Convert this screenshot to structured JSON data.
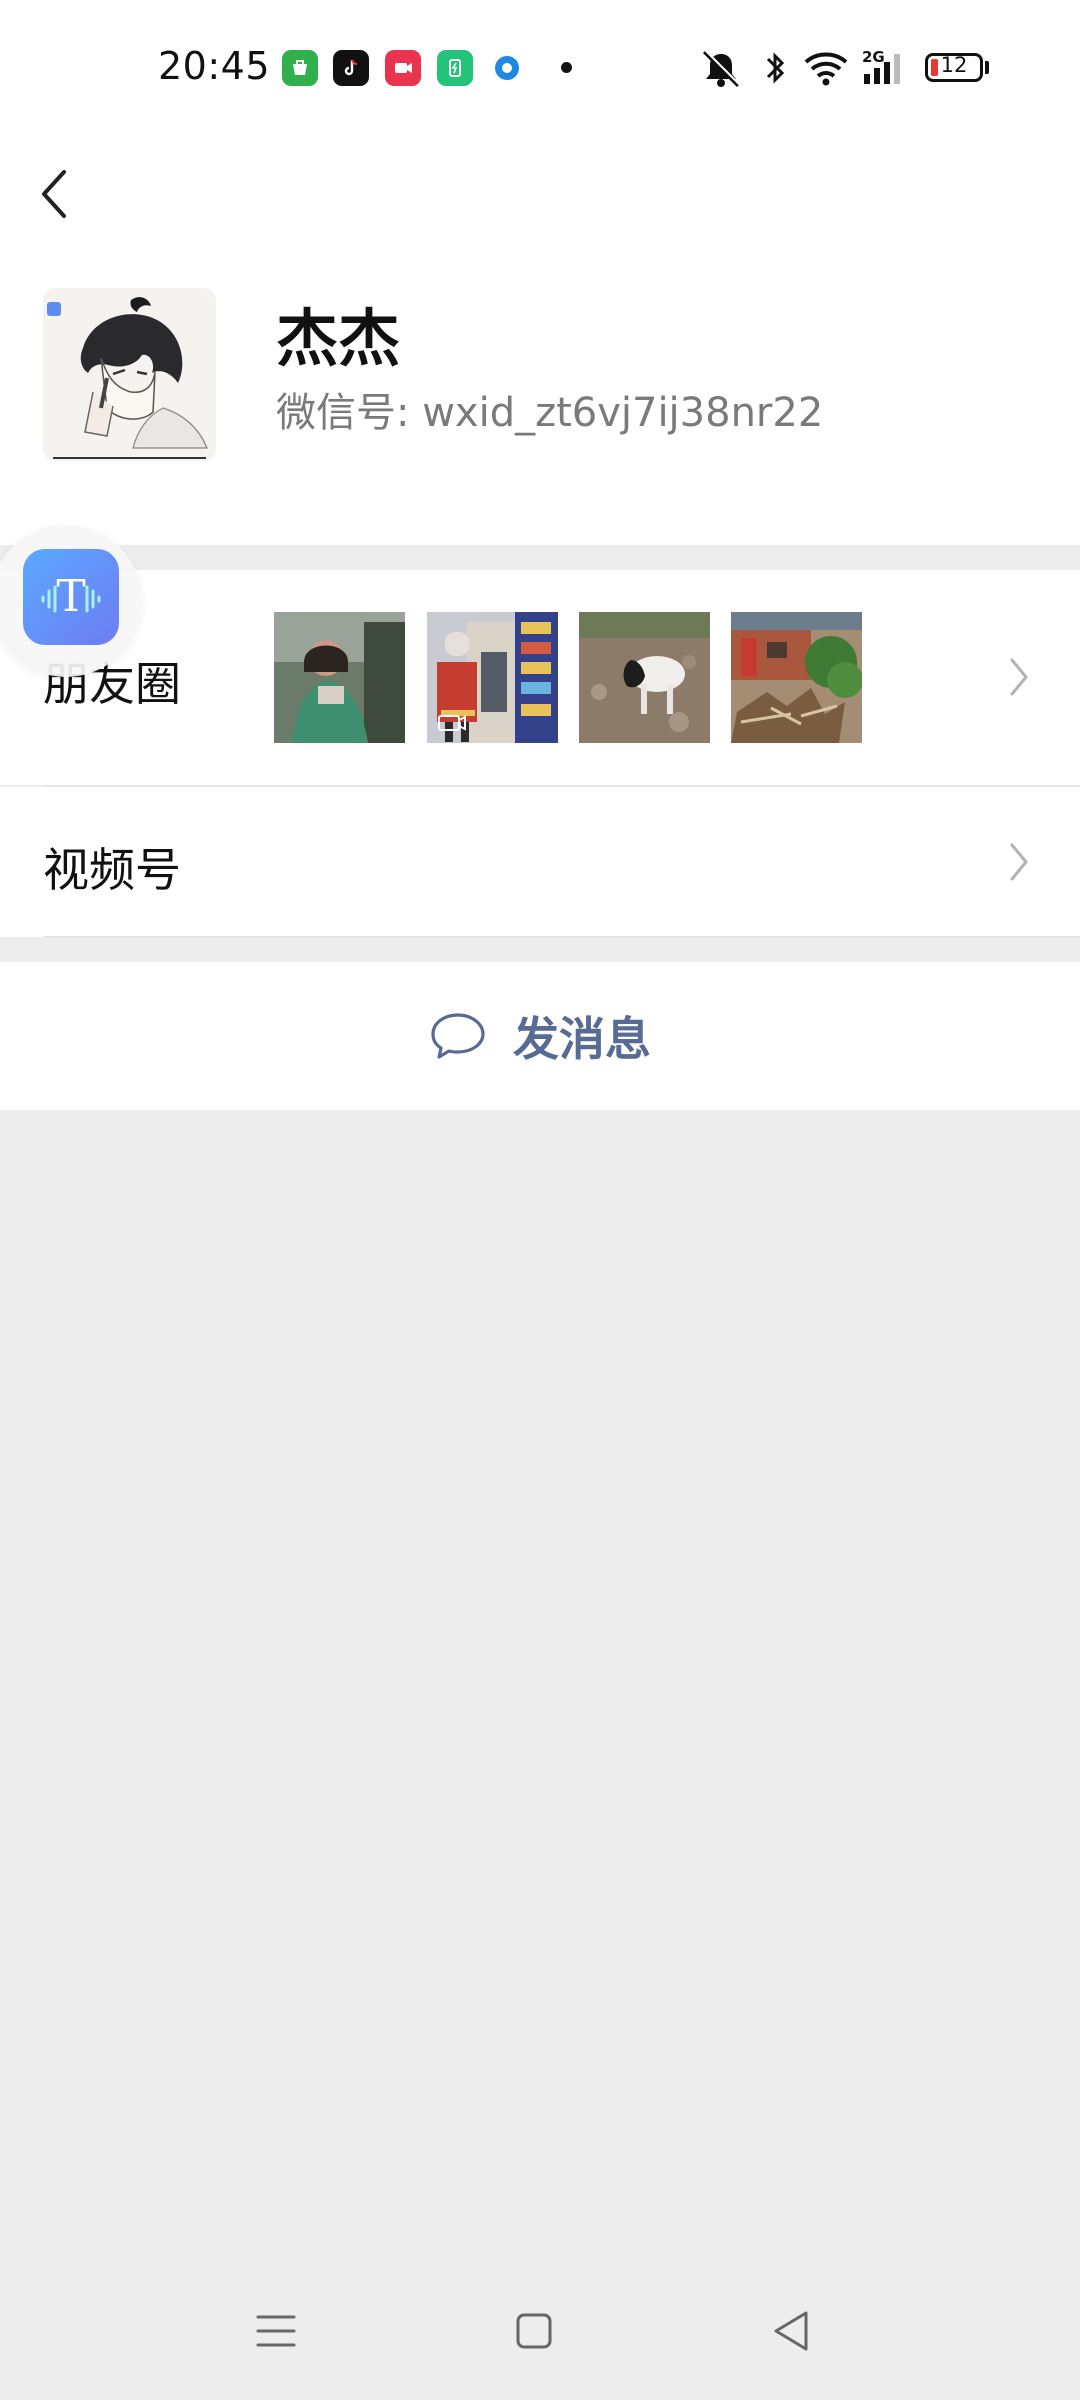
{
  "status": {
    "time": "20:45",
    "battery": "12",
    "network": "2G"
  },
  "profile": {
    "name": "杰杰",
    "wechat_id": "微信号: wxid_zt6vj7ij38nr22"
  },
  "rows": {
    "moments_label": "朋友圈",
    "video_label": "视频号"
  },
  "actions": {
    "message_label": "发消息"
  },
  "float_button": {
    "glyph": "T"
  },
  "colors": {
    "link": "#576b95",
    "background": "#ededed",
    "battery_low": "#e53935"
  },
  "icons": {
    "back": "chevron-left-icon",
    "chevron": "chevron-right-icon",
    "message": "speech-bubble-icon",
    "nav_menu": "menu-icon",
    "nav_home": "square-icon",
    "nav_back": "triangle-back-icon"
  }
}
